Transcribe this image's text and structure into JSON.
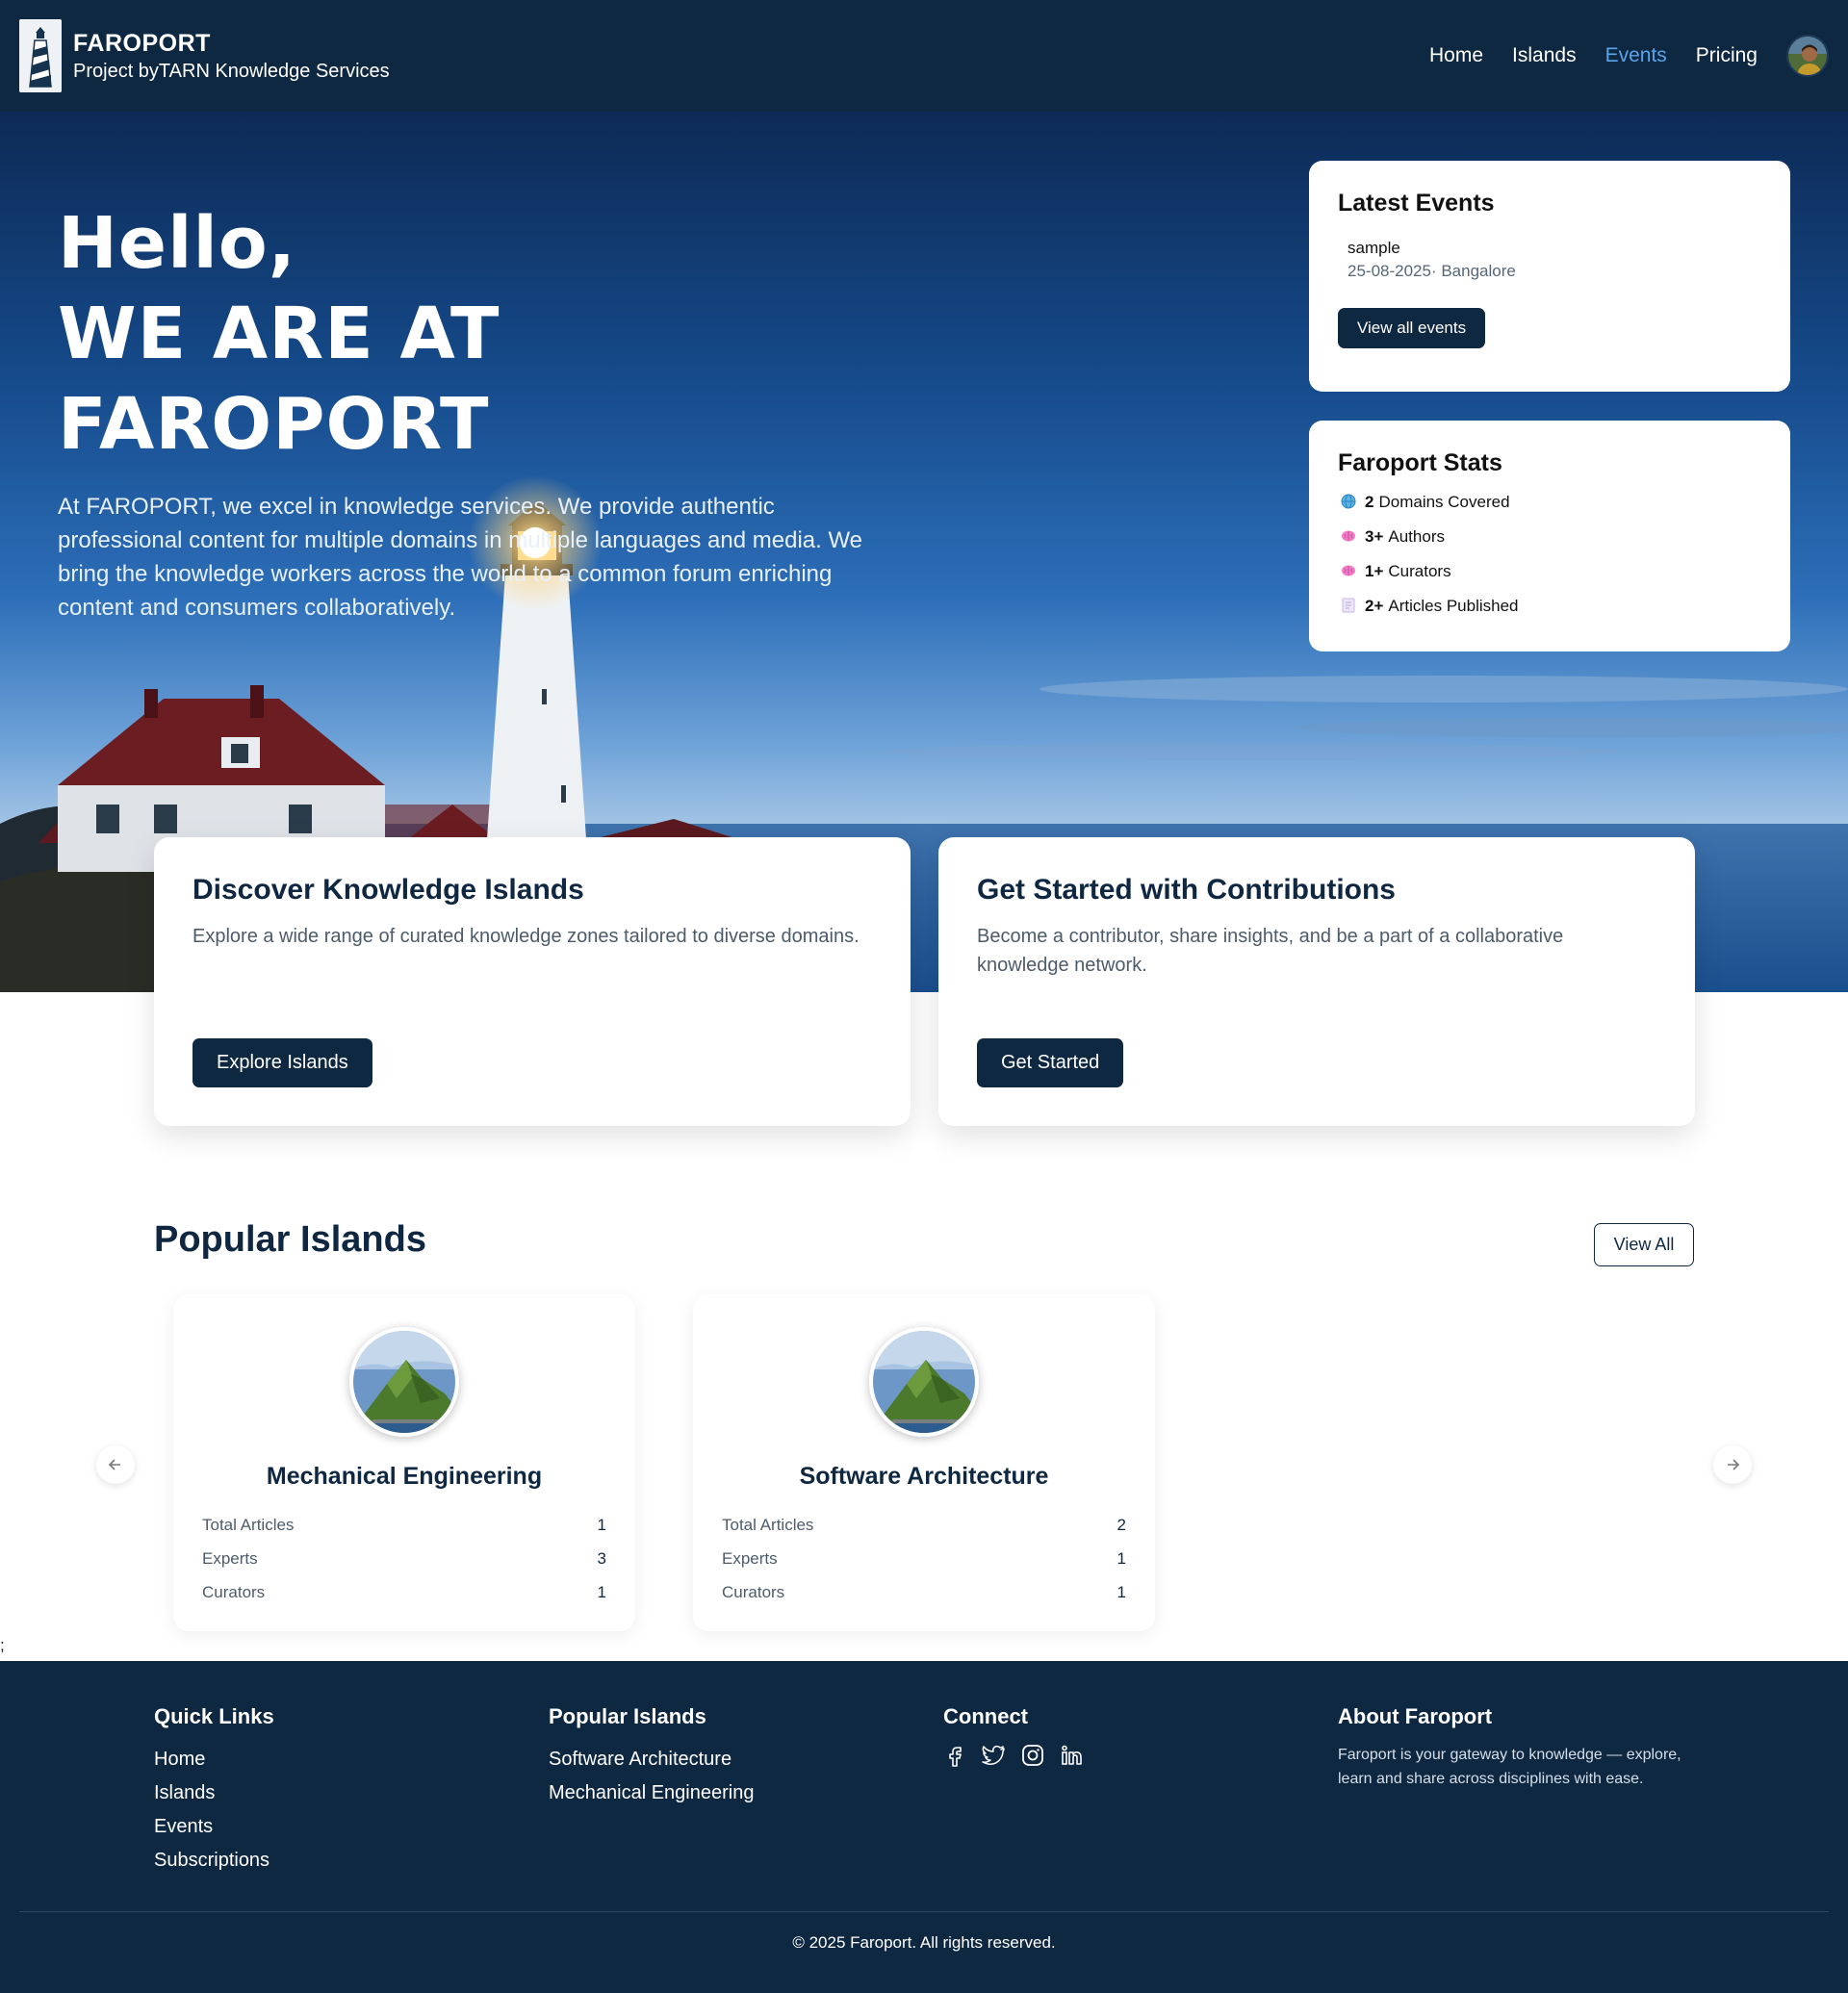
{
  "nav": {
    "brand_title": "FAROPORT",
    "brand_subtitle": "Project byTARN Knowledge Services",
    "links": [
      {
        "label": "Home"
      },
      {
        "label": "Islands"
      },
      {
        "label": "Events",
        "active": true
      },
      {
        "label": "Pricing"
      }
    ]
  },
  "hero": {
    "title_line1": "Hello,",
    "title_line2": "WE ARE AT",
    "title_line3": "FAROPORT",
    "description": "At FAROPORT, we excel in knowledge services. We provide authentic professional content for multiple domains in multiple languages and media. We bring the knowledge workers across the world to a common forum enriching content and consumers collaboratively."
  },
  "latest_events": {
    "title": "Latest Events",
    "event_name": "sample",
    "event_meta": "25-08-2025· Bangalore",
    "button": "View all events"
  },
  "stats": {
    "title": "Faroport Stats",
    "items": [
      {
        "icon": "globe-icon",
        "value": "2",
        "label": "Domains Covered"
      },
      {
        "icon": "brain-icon",
        "value": "3+",
        "label": "Authors"
      },
      {
        "icon": "brain-icon",
        "value": "1+",
        "label": "Curators"
      },
      {
        "icon": "document-icon",
        "value": "2+",
        "label": "Articles Published"
      }
    ]
  },
  "features": [
    {
      "title": "Discover Knowledge Islands",
      "text": "Explore a wide range of curated knowledge zones tailored to diverse domains.",
      "button": "Explore Islands"
    },
    {
      "title": "Get Started with Contributions",
      "text": "Become a contributor, share insights, and be a part of a collaborative knowledge network.",
      "button": "Get Started"
    }
  ],
  "popular": {
    "title": "Popular Islands",
    "view_all": "View All",
    "islands": [
      {
        "name": "Mechanical Engineering",
        "rows": [
          {
            "label": "Total Articles",
            "value": "1"
          },
          {
            "label": "Experts",
            "value": "3"
          },
          {
            "label": "Curators",
            "value": "1"
          }
        ]
      },
      {
        "name": "Software Architecture",
        "rows": [
          {
            "label": "Total Articles",
            "value": "2"
          },
          {
            "label": "Experts",
            "value": "1"
          },
          {
            "label": "Curators",
            "value": "1"
          }
        ]
      }
    ]
  },
  "stray_text": ";",
  "footer": {
    "quick_links_title": "Quick Links",
    "quick_links": [
      "Home",
      "Islands",
      "Events",
      "Subscriptions"
    ],
    "popular_title": "Popular Islands",
    "popular_links": [
      "Software Architecture",
      "Mechanical Engineering"
    ],
    "connect_title": "Connect",
    "social": [
      "facebook-icon",
      "twitter-icon",
      "instagram-icon",
      "linkedin-icon"
    ],
    "about_title": "About Faroport",
    "about_text": "Faroport is your gateway to knowledge — explore, learn and share across disciplines with ease.",
    "copyright": "© 2025 Faroport. All rights reserved."
  },
  "colors": {
    "navy": "#0e2842",
    "active_link": "#5aa3ea",
    "heading": "#0f2741"
  }
}
